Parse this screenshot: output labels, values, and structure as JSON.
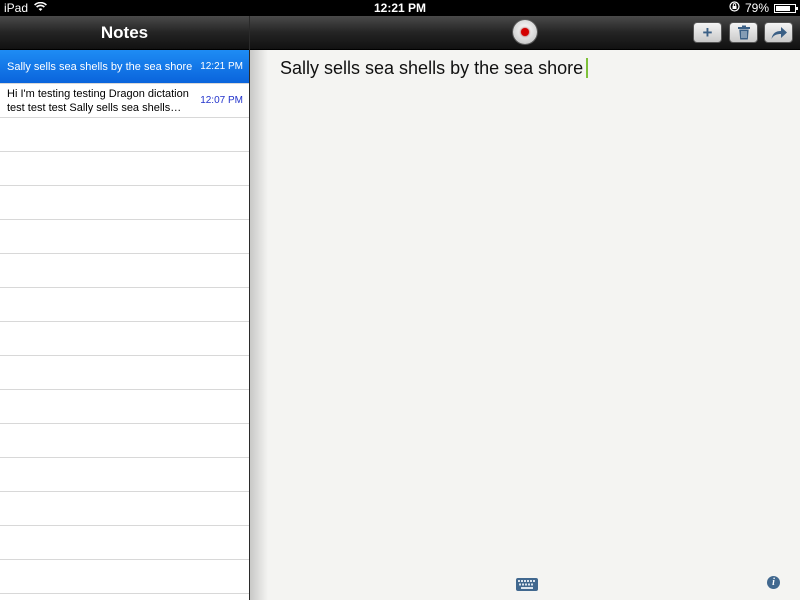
{
  "status_bar": {
    "device": "iPad",
    "time": "12:21 PM",
    "battery": "79%",
    "battery_level": 0.79
  },
  "sidebar": {
    "title": "Notes",
    "notes": [
      {
        "text": "Sally sells sea shells by the sea shore",
        "time": "12:21 PM",
        "selected": true
      },
      {
        "text": "Hi I'm testing testing Dragon dictation test test test Sally sells sea shells…",
        "time": "12:07 PM",
        "selected": false
      }
    ]
  },
  "toolbar": {
    "record_icon": "record-icon",
    "add_label": "+",
    "trash_icon": "trash-icon",
    "share_icon": "share-arrow-icon"
  },
  "editor": {
    "content": "Sally sells sea shells by the sea shore"
  },
  "colors": {
    "selection": "#0a64dc",
    "time_text": "#2233cc",
    "caret": "#7ec13a",
    "record": "#d40000"
  }
}
